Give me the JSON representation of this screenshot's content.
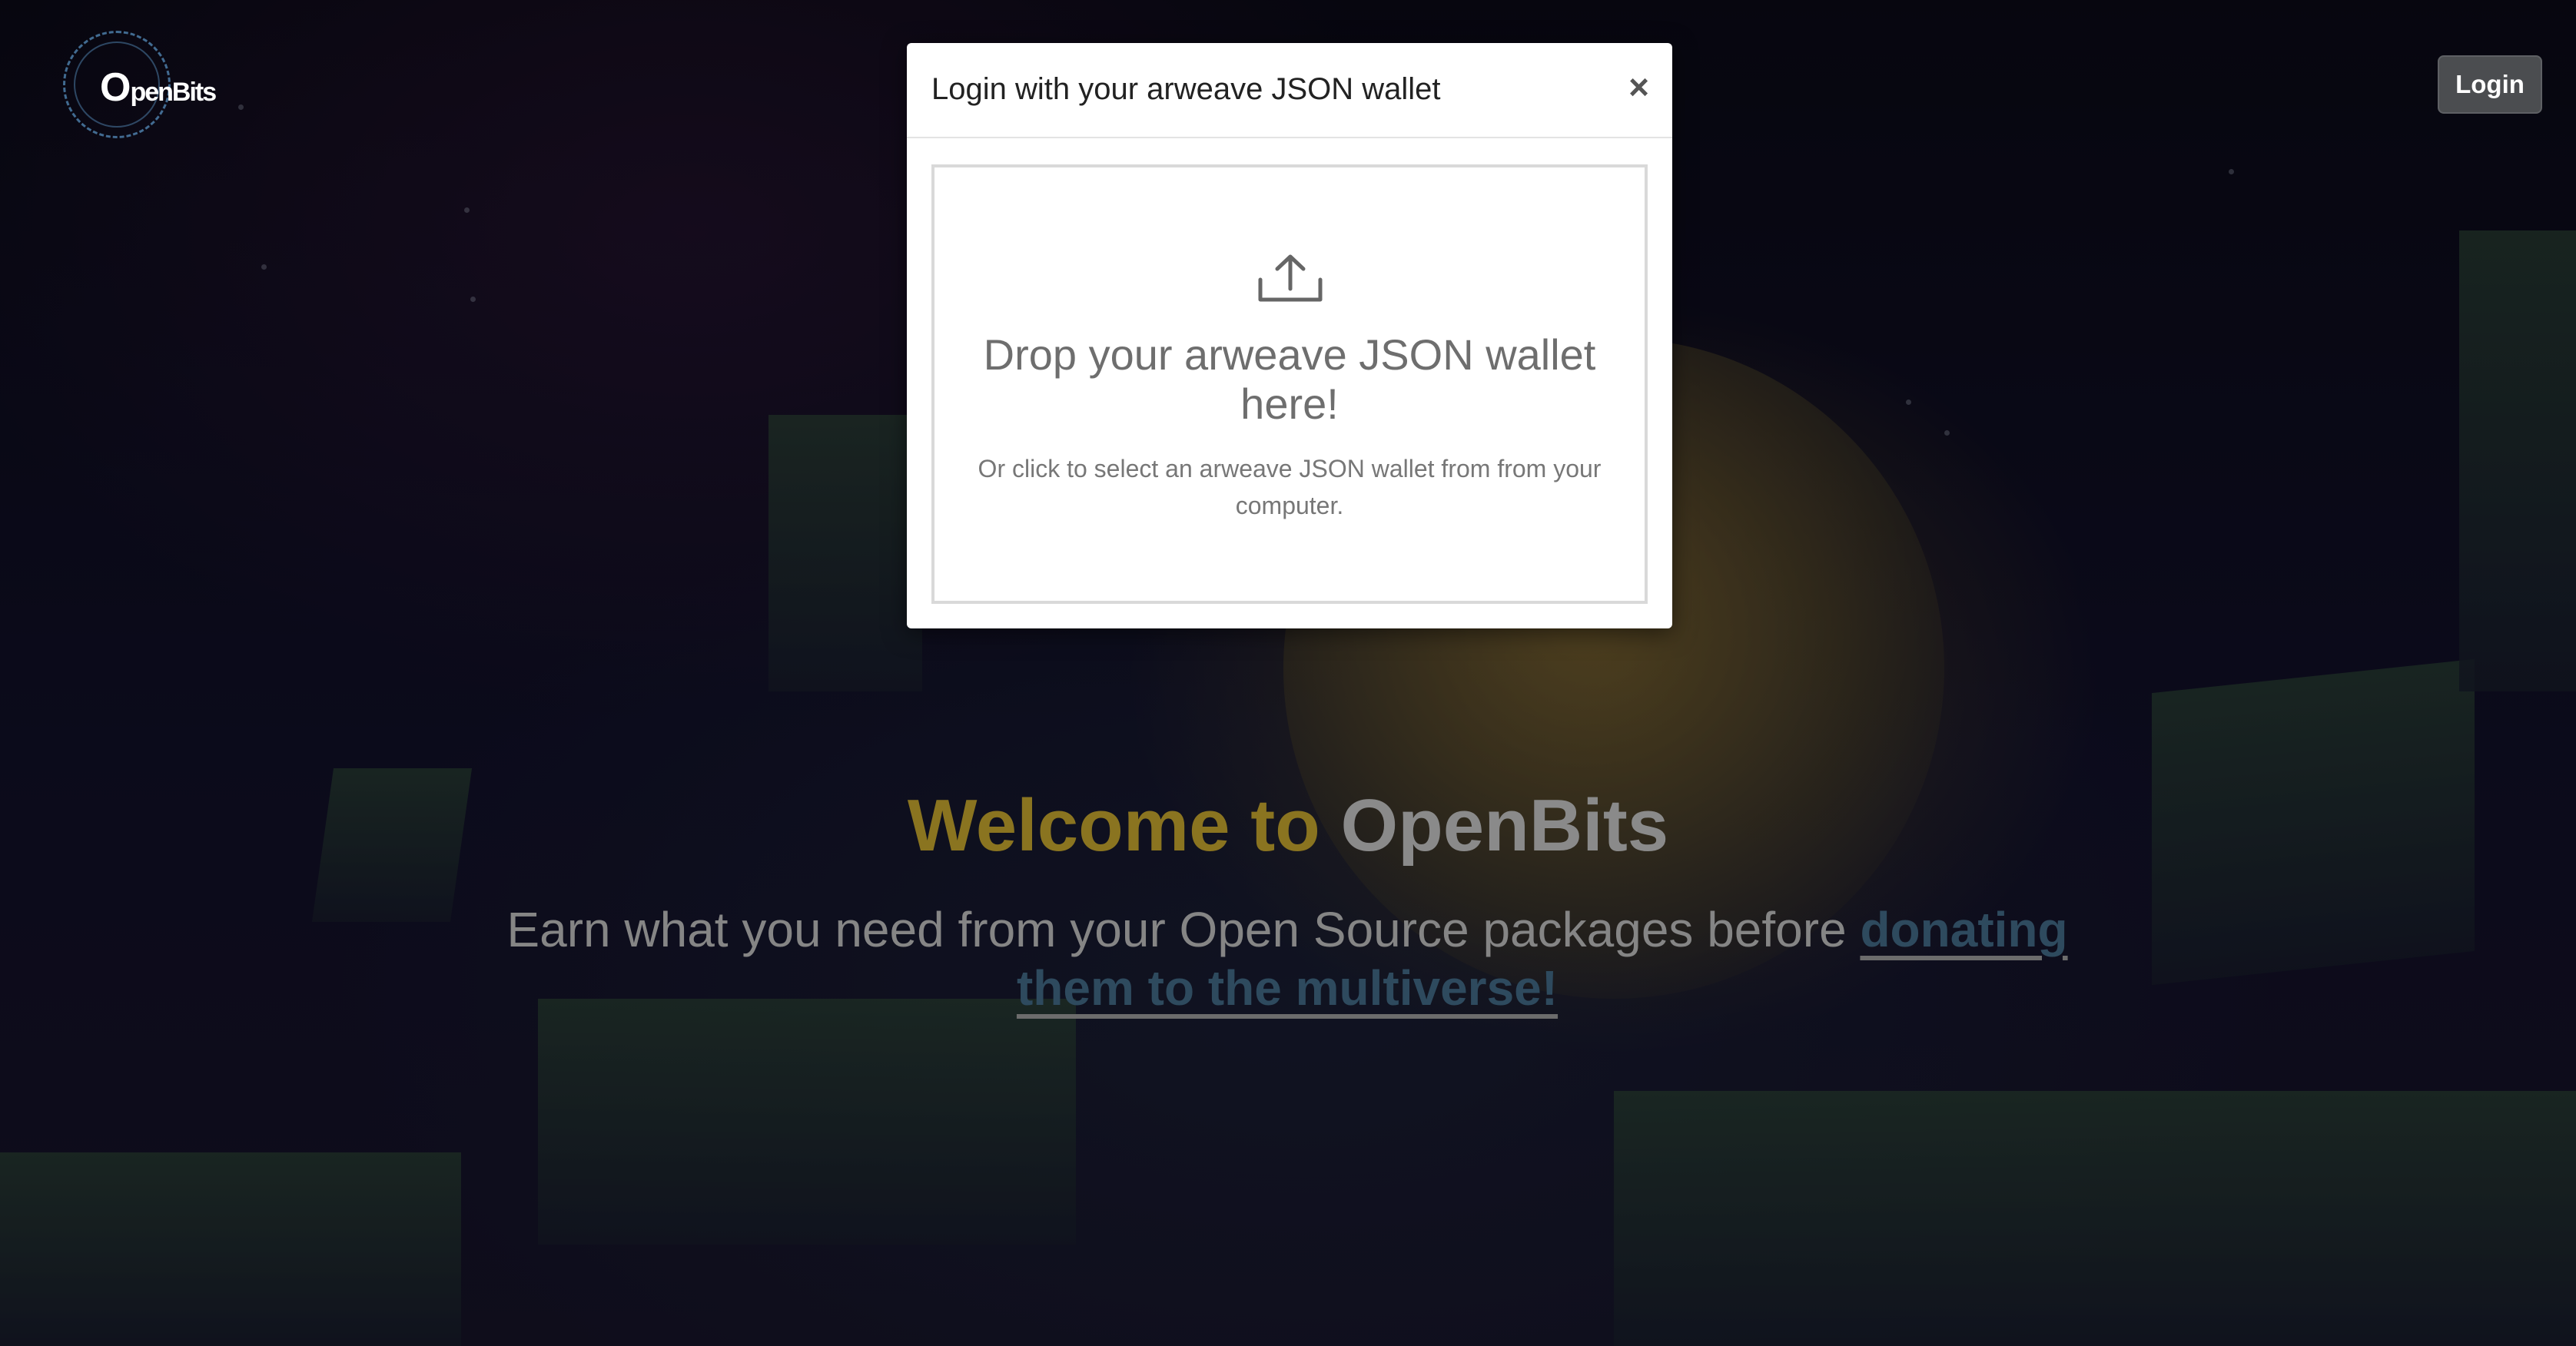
{
  "header": {
    "logo_text_big": "O",
    "logo_text_rest": "penBits",
    "login_label": "Login"
  },
  "modal": {
    "title": "Login with your arweave JSON wallet",
    "close_glyph": "×",
    "dropzone": {
      "icon": "upload-icon",
      "title": "Drop your arweave JSON wallet here!",
      "subtitle": "Or click to select an arweave JSON wallet from from your computer."
    }
  },
  "hero": {
    "title_prefix": "Welcome to",
    "title_brand": "OpenBits",
    "subtitle_text": "Earn what you need from your Open Source packages before",
    "subtitle_link": "donating them to the multiverse!"
  },
  "colors": {
    "accent_yellow": "#8a7420",
    "link": "#2e4a5e",
    "login_button": "#4b4d50"
  }
}
